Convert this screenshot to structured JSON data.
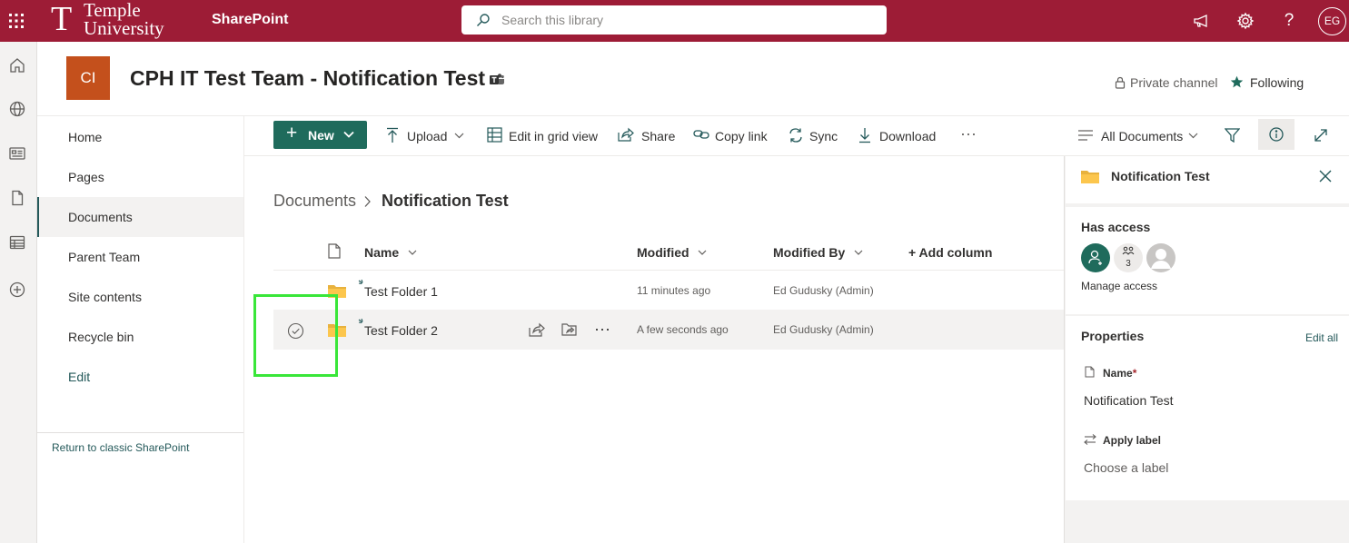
{
  "suite": {
    "logo_t": "T",
    "logo_line1": "Temple",
    "logo_line2": "University",
    "app_name": "SharePoint",
    "search_placeholder": "Search this library",
    "avatar_initials": "EG"
  },
  "site": {
    "logo_initials": "CI",
    "title": "CPH IT Test Team - Notification Test",
    "private_label": "Private channel",
    "following_label": "Following"
  },
  "nav": {
    "items": [
      {
        "label": "Home"
      },
      {
        "label": "Pages"
      },
      {
        "label": "Documents"
      },
      {
        "label": "Parent Team"
      },
      {
        "label": "Site contents"
      },
      {
        "label": "Recycle bin"
      },
      {
        "label": "Edit"
      }
    ],
    "classic_link": "Return to classic SharePoint"
  },
  "commands": {
    "new": "New",
    "upload": "Upload",
    "grid": "Edit in grid view",
    "share": "Share",
    "copy_link": "Copy link",
    "sync": "Sync",
    "download": "Download",
    "more": "···",
    "view": "All Documents"
  },
  "breadcrumb": {
    "root": "Documents",
    "current": "Notification Test"
  },
  "list": {
    "columns": {
      "name": "Name",
      "modified": "Modified",
      "modified_by": "Modified By",
      "add_column": "+ Add column"
    },
    "rows": [
      {
        "name": "Test Folder 1",
        "modified": "11 minutes ago",
        "modified_by": "Ed Gudusky (Admin)",
        "selected": false
      },
      {
        "name": "Test Folder 2",
        "modified": "A few seconds ago",
        "modified_by": "Ed Gudusky (Admin)",
        "selected": true
      }
    ],
    "row_more": "···"
  },
  "details": {
    "title": "Notification Test",
    "has_access": "Has access",
    "group_count": "3",
    "manage_access": "Manage access",
    "properties": "Properties",
    "edit_all": "Edit all",
    "name_label": "Name",
    "required_mark": "*",
    "name_value": "Notification Test",
    "apply_label": "Apply label",
    "label_placeholder": "Choose a label"
  },
  "colors": {
    "suite_bar": "#9d1c36",
    "theme": "#1f6b5c",
    "site_logo": "#c4501c",
    "highlight": "#39e639"
  }
}
